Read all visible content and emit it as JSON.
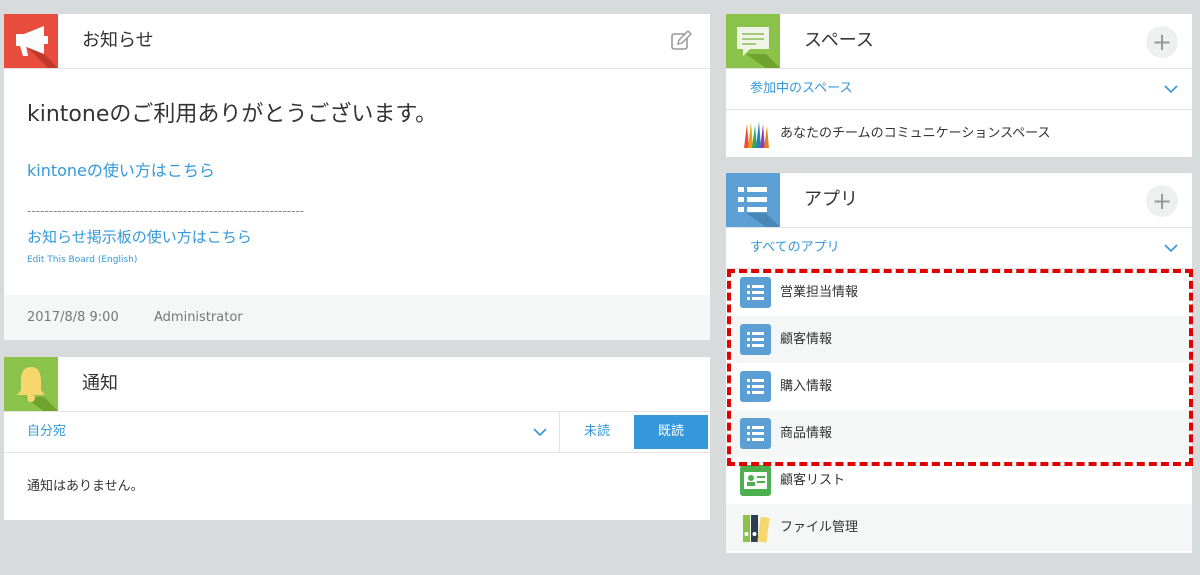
{
  "notice": {
    "title": "お知らせ",
    "message": "kintoneのご利用ありがとうございます。",
    "link_howto": "kintoneの使い方はこちら",
    "dashes": "----------------------------------------------------------------",
    "link_board_howto": "お知らせ掲示板の使い方はこちら",
    "link_board_en": "Edit This Board (English)",
    "footer_date": "2017/8/8 9:00",
    "footer_author": "Administrator"
  },
  "notifications": {
    "title": "通知",
    "filter": "自分宛",
    "tab_unread": "未読",
    "tab_read": "既読",
    "empty": "通知はありません。"
  },
  "spaces": {
    "title": "スペース",
    "plus": "+",
    "filter": "参加中のスペース",
    "items": [
      {
        "label": "あなたのチームのコミュニケーションスペース"
      }
    ]
  },
  "apps": {
    "title": "アプリ",
    "plus": "+",
    "filter": "すべてのアプリ",
    "items": [
      {
        "label": "営業担当情報"
      },
      {
        "label": "顧客情報"
      },
      {
        "label": "購入情報"
      },
      {
        "label": "商品情報"
      },
      {
        "label": "顧客リスト"
      },
      {
        "label": "ファイル管理"
      }
    ]
  },
  "colors": {
    "notice_icon": "#e74c3c",
    "notif_icon": "#8bc34a",
    "space_icon": "#8bc34a",
    "app_icon": "#5b9fd4",
    "link": "#3498db",
    "highlight": "#e00000"
  }
}
